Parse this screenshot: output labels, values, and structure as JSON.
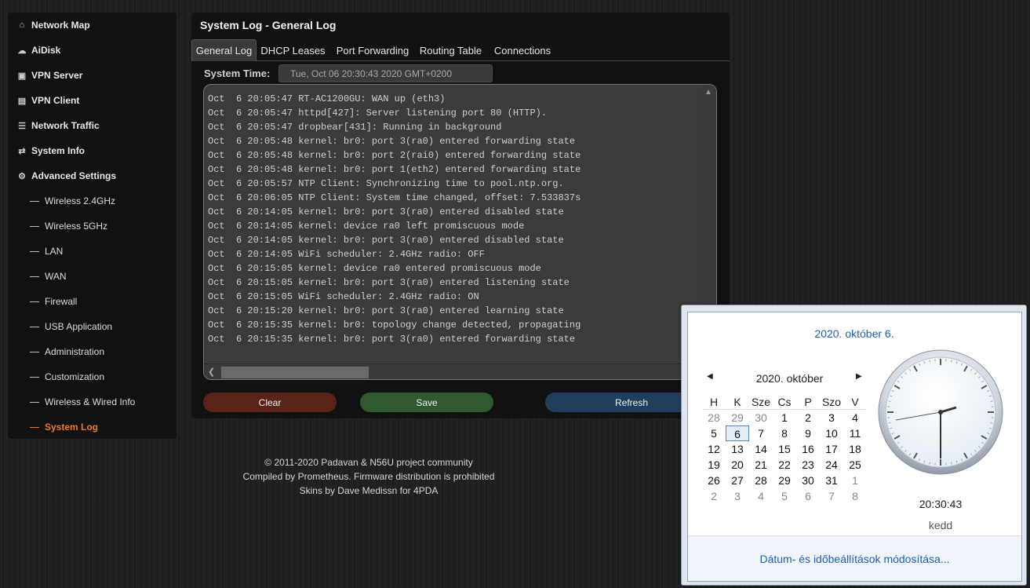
{
  "sidebar": {
    "items": [
      {
        "label": "Network Map",
        "icon": "home-icon"
      },
      {
        "label": "AiDisk",
        "icon": "disk-icon"
      },
      {
        "label": "VPN Server",
        "icon": "vpn-server-icon"
      },
      {
        "label": "VPN Client",
        "icon": "vpn-client-icon"
      },
      {
        "label": "Network Traffic",
        "icon": "traffic-icon"
      },
      {
        "label": "System Info",
        "icon": "shuffle-icon"
      },
      {
        "label": "Advanced Settings",
        "icon": "gear-icon"
      }
    ],
    "subitems": [
      "Wireless 2.4GHz",
      "Wireless 5GHz",
      "LAN",
      "WAN",
      "Firewall",
      "USB Application",
      "Administration",
      "Customization",
      "Wireless & Wired Info",
      "System Log"
    ],
    "active_subitem": "System Log",
    "active_color": "#f07a1c"
  },
  "panel": {
    "title": "System Log - General Log",
    "tabs": [
      "General Log",
      "DHCP Leases",
      "Port Forwarding",
      "Routing Table",
      "Connections"
    ],
    "active_tab": "General Log",
    "system_time_label": "System Time:",
    "system_time_value": "Tue, Oct 06 20:30:43 2020 GMT+0200",
    "log_lines": [
      "Oct  6 20:05:47 RT-AC1200GU: WAN up (eth3)",
      "Oct  6 20:05:47 httpd[427]: Server listening port 80 (HTTP).",
      "Oct  6 20:05:47 dropbear[431]: Running in background",
      "Oct  6 20:05:48 kernel: br0: port 3(ra0) entered forwarding state",
      "Oct  6 20:05:48 kernel: br0: port 2(rai0) entered forwarding state",
      "Oct  6 20:05:48 kernel: br0: port 1(eth2) entered forwarding state",
      "Oct  6 20:05:57 NTP Client: Synchronizing time to pool.ntp.org.",
      "Oct  6 20:06:05 NTP Client: System time changed, offset: 7.533837s",
      "Oct  6 20:14:05 kernel: br0: port 3(ra0) entered disabled state",
      "Oct  6 20:14:05 kernel: device ra0 left promiscuous mode",
      "Oct  6 20:14:05 kernel: br0: port 3(ra0) entered disabled state",
      "Oct  6 20:14:05 WiFi scheduler: 2.4GHz radio: OFF",
      "Oct  6 20:15:05 kernel: device ra0 entered promiscuous mode",
      "Oct  6 20:15:05 kernel: br0: port 3(ra0) entered listening state",
      "Oct  6 20:15:05 WiFi scheduler: 2.4GHz radio: ON",
      "Oct  6 20:15:20 kernel: br0: port 3(ra0) entered learning state",
      "Oct  6 20:15:35 kernel: br0: topology change detected, propagating",
      "Oct  6 20:15:35 kernel: br0: port 3(ra0) entered forwarding state"
    ],
    "buttons": {
      "clear": "Clear",
      "save": "Save",
      "refresh": "Refresh"
    }
  },
  "footer": {
    "lines": [
      "© 2011-2020 Padavan & N56U project community",
      "Compiled by Prometheus. Firmware distribution is prohibited",
      "Skins by Dave Medissn for 4PDA"
    ]
  },
  "calendar": {
    "date_title": "2020. október 6.",
    "month_label": "2020. október",
    "weekday_headers": [
      "H",
      "K",
      "Sze",
      "Cs",
      "P",
      "Szo",
      "V"
    ],
    "weeks": [
      [
        {
          "d": "28",
          "o": true
        },
        {
          "d": "29",
          "o": true
        },
        {
          "d": "30",
          "o": true
        },
        {
          "d": "1"
        },
        {
          "d": "2"
        },
        {
          "d": "3"
        },
        {
          "d": "4"
        }
      ],
      [
        {
          "d": "5"
        },
        {
          "d": "6",
          "t": true
        },
        {
          "d": "7"
        },
        {
          "d": "8"
        },
        {
          "d": "9"
        },
        {
          "d": "10"
        },
        {
          "d": "11"
        }
      ],
      [
        {
          "d": "12"
        },
        {
          "d": "13"
        },
        {
          "d": "14"
        },
        {
          "d": "15"
        },
        {
          "d": "16"
        },
        {
          "d": "17"
        },
        {
          "d": "18"
        }
      ],
      [
        {
          "d": "19"
        },
        {
          "d": "20"
        },
        {
          "d": "21"
        },
        {
          "d": "22"
        },
        {
          "d": "23"
        },
        {
          "d": "24"
        },
        {
          "d": "25"
        }
      ],
      [
        {
          "d": "26"
        },
        {
          "d": "27"
        },
        {
          "d": "28"
        },
        {
          "d": "29"
        },
        {
          "d": "30"
        },
        {
          "d": "31"
        },
        {
          "d": "1",
          "o": true
        }
      ],
      [
        {
          "d": "2",
          "o": true
        },
        {
          "d": "3",
          "o": true
        },
        {
          "d": "4",
          "o": true
        },
        {
          "d": "5",
          "o": true
        },
        {
          "d": "6",
          "o": true
        },
        {
          "d": "7",
          "o": true
        },
        {
          "d": "8",
          "o": true
        }
      ]
    ],
    "clock_time": "20:30:43",
    "clock_day": "kedd",
    "settings_link": "Dátum- és időbeállítások módosítása..."
  }
}
